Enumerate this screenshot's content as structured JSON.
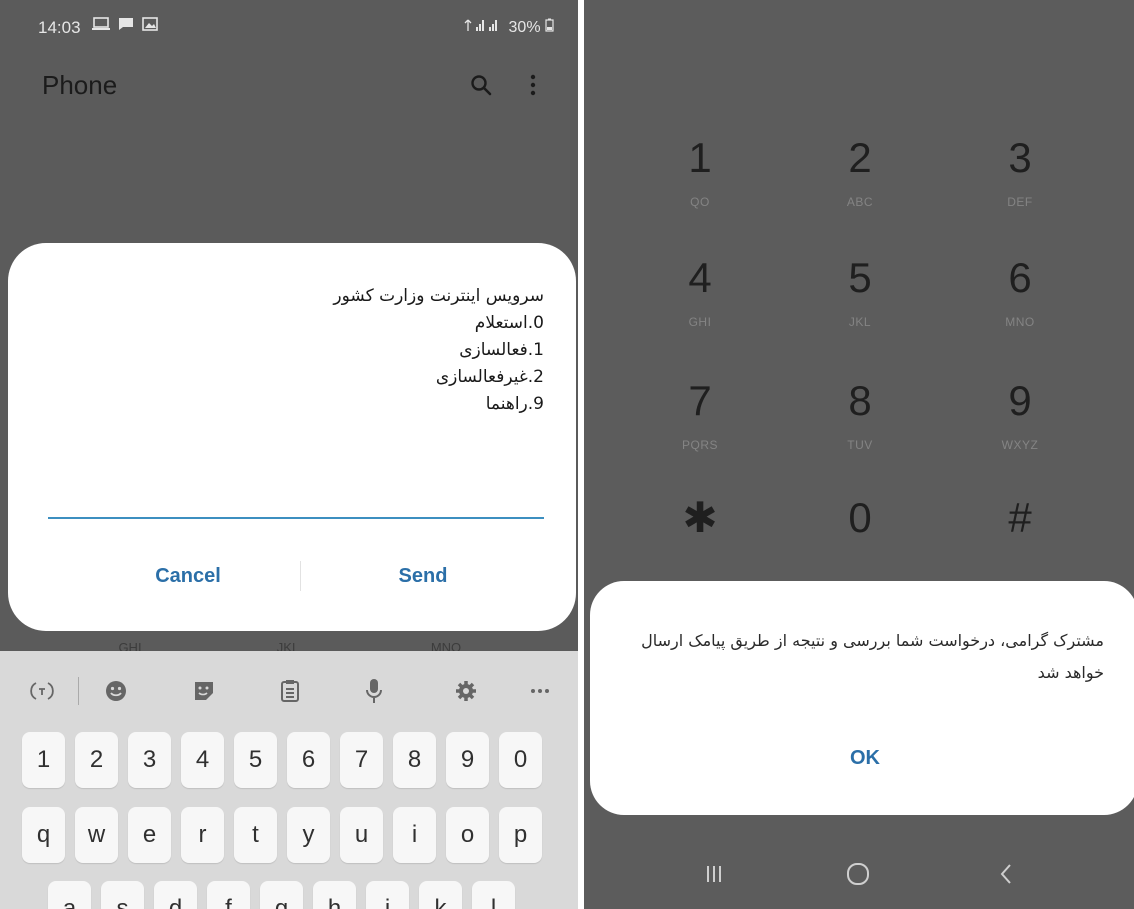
{
  "left": {
    "status": {
      "time": "14:03",
      "right": "30%"
    },
    "app_title": "Phone",
    "behind_letters": [
      "GHI",
      "JKL",
      "MNO"
    ],
    "ussd": {
      "message": "سرویس اینترنت وزارت کشور\n0.استعلام\n1.فعالسازی\n2.غیرفعالسازی\n9.راهنما",
      "cancel_label": "Cancel",
      "send_label": "Send"
    },
    "keyboard": {
      "number_row": [
        "1",
        "2",
        "3",
        "4",
        "5",
        "6",
        "7",
        "8",
        "9",
        "0"
      ],
      "letter_row": [
        "q",
        "w",
        "e",
        "r",
        "t",
        "y",
        "u",
        "i",
        "o",
        "p"
      ],
      "second_row": [
        "a",
        "s",
        "d",
        "f",
        "g",
        "h",
        "j",
        "k",
        "l"
      ]
    }
  },
  "right": {
    "dialpad": [
      {
        "num": "1",
        "letters": "QO"
      },
      {
        "num": "2",
        "letters": "ABC"
      },
      {
        "num": "3",
        "letters": "DEF"
      },
      {
        "num": "4",
        "letters": "GHI"
      },
      {
        "num": "5",
        "letters": "JKL"
      },
      {
        "num": "6",
        "letters": "MNO"
      },
      {
        "num": "7",
        "letters": "PQRS"
      },
      {
        "num": "8",
        "letters": "TUV"
      },
      {
        "num": "9",
        "letters": "WXYZ"
      },
      {
        "num": "✱",
        "letters": ""
      },
      {
        "num": "0",
        "letters": ""
      },
      {
        "num": "#",
        "letters": ""
      }
    ],
    "info": {
      "message": "مشترک گرامی، درخواست شما بررسی و نتیجه از طریق پیامک ارسال خواهد شد",
      "ok_label": "OK"
    },
    "nav": {
      "recents": "|||",
      "home": "○",
      "back": "‹"
    }
  }
}
